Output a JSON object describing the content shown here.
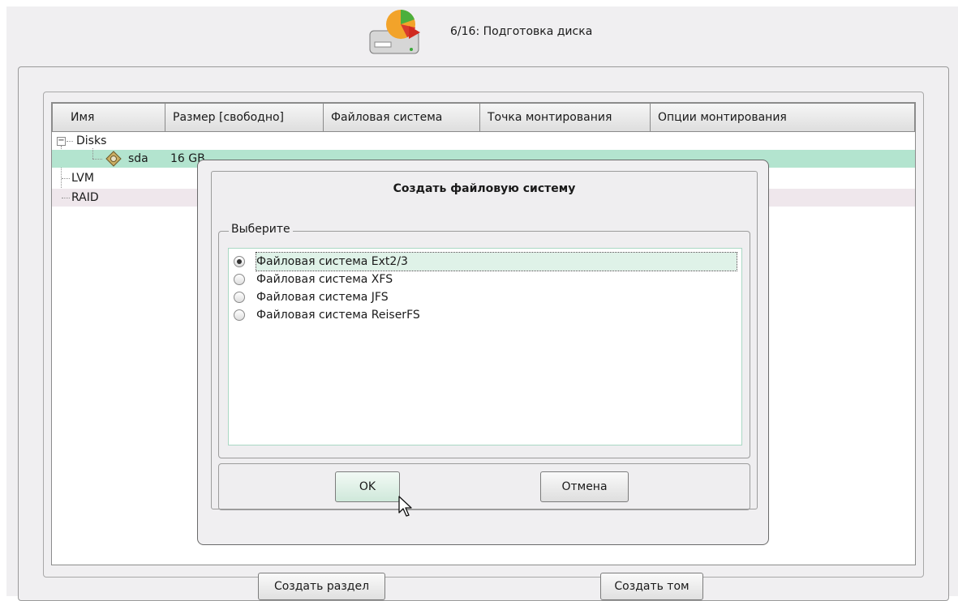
{
  "header": {
    "step_title": "6/16: Подготовка диска",
    "icon": "disk-partition-icon"
  },
  "table": {
    "columns": [
      "Имя",
      "Размер [свободно]",
      "Файловая система",
      "Точка монтирования",
      "Опции монтирования"
    ],
    "rows": {
      "disks": "Disks",
      "sda_name": "sda",
      "sda_size": "16 GB",
      "lvm": "LVM",
      "raid": "RAID"
    }
  },
  "dialog": {
    "title": "Создать файловую систему",
    "group_label": "Выберите",
    "options": [
      "Файловая система Ext2/3",
      "Файловая система XFS",
      "Файловая система JFS",
      "Файловая система ReiserFS"
    ],
    "selected_index": 0,
    "ok_label": "OK",
    "cancel_label": "Отмена"
  },
  "actions": {
    "create_partition": "Создать раздел",
    "create_volume": "Создать том"
  }
}
